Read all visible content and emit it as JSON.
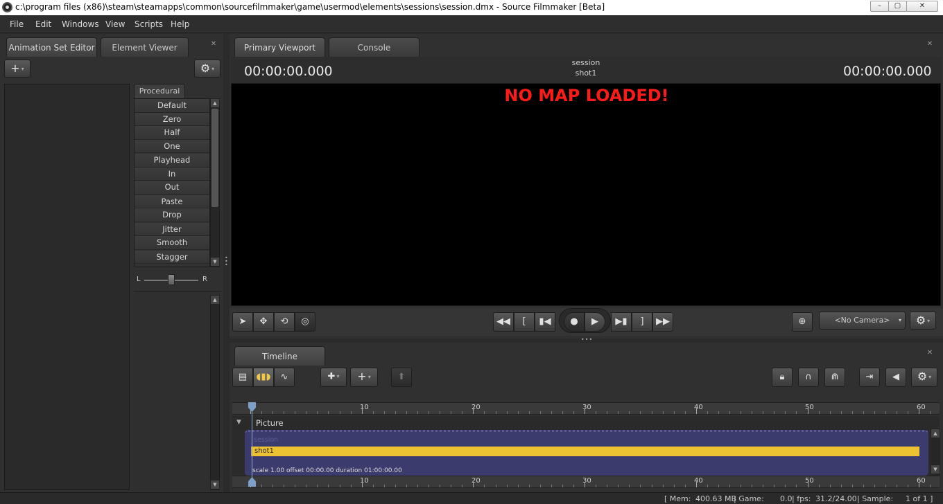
{
  "window": {
    "title": "c:\\program files (x86)\\steam\\steamapps\\common\\sourcefilmmaker\\game\\usermod\\elements\\sessions\\session.dmx - Source Filmmaker [Beta]",
    "min": "–",
    "max": "▢",
    "close": "✕"
  },
  "menu": [
    "File",
    "Edit",
    "Windows",
    "View",
    "Scripts",
    "Help"
  ],
  "left_panel": {
    "tabs": [
      "Animation Set Editor",
      "Element Viewer"
    ],
    "procedural_tab": "Procedural",
    "procedural_items": [
      "Default",
      "Zero",
      "Half",
      "One",
      "Playhead",
      "In",
      "Out",
      "Paste",
      "Drop",
      "Jitter",
      "Smooth",
      "Stagger"
    ],
    "slider_left": "L",
    "slider_right": "R",
    "add_icon": "+",
    "gear_icon": "⚙",
    "close_icon": "✕"
  },
  "viewport": {
    "tabs": [
      "Primary Viewport",
      "Console"
    ],
    "timecode_left": "00:00:00.000",
    "timecode_right": "00:00:00.000",
    "session_label": "session",
    "shot_label": "shot1",
    "no_map": "NO MAP LOADED!",
    "camera": "<No Camera>",
    "close_icon": "✕"
  },
  "timeline": {
    "tab": "Timeline",
    "ruler_ticks": [
      "10",
      "20",
      "30",
      "40",
      "50",
      "60"
    ],
    "track_label": "Picture",
    "session_clip": "session",
    "shot_clip": "shot1",
    "shot_info": "scale 1.00 offset  00:00.00 duration  01:00:00.00",
    "close_icon": "✕"
  },
  "status": {
    "mem_label": "[ Mem:",
    "mem_value": "400.63 MB",
    "game_label": "| Game:",
    "game_value": "0.0",
    "fps_label": "| fps:",
    "fps_value": "31.2/24.00",
    "sample_label": "| Sample:",
    "sample_value": "1 of 1 ]"
  },
  "colors": {
    "no_map_red": "#ff1a1a",
    "shot_yellow": "#ecc233",
    "session_purple": "#3c3b6d",
    "background": "#2b2b2b"
  }
}
